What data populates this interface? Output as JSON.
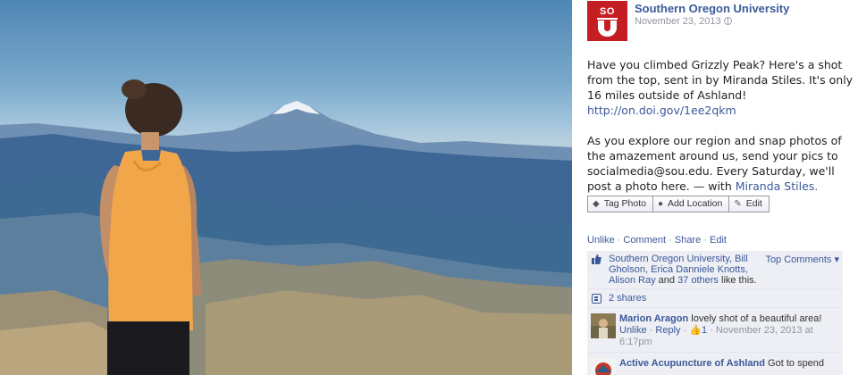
{
  "post": {
    "page_name": "Southern Oregon University",
    "date": "November 23, 2013",
    "privacy_icon": "globe-icon",
    "logo_text": "SO",
    "caption_p1": "Have you climbed Grizzly Peak? Here's a shot from the top, sent in by Miranda Stiles. It's only 16 miles outside of Ashland!",
    "link": "http://on.doi.gov/1ee2qkm",
    "caption_p2": "As you explore our region and snap photos of the amazement around us, send your pics to socialmedia@sou.edu. Every Saturday, we'll post a photo here. — with",
    "tagged_person": "Miranda Stiles."
  },
  "photo_actions": {
    "tag_photo": "Tag Photo",
    "add_location": "Add Location",
    "edit": "Edit"
  },
  "actions": {
    "unlike": "Unlike",
    "comment": "Comment",
    "share": "Share",
    "edit": "Edit",
    "separator": "·"
  },
  "likes": {
    "names": "Southern Oregon University, Bill Gholson, Erica Danniele Knotts, Alison Ray",
    "and": "and",
    "others": "37 others",
    "suffix": "like this.",
    "top_comments": "Top Comments ▾"
  },
  "shares": {
    "label": "2 shares"
  },
  "comments": [
    {
      "author": "Marion Aragon",
      "text": "lovely shot of a beautiful area!",
      "unlike": "Unlike",
      "reply": "Reply",
      "likes": "1",
      "timestamp": "November 23, 2013 at 6:17pm"
    },
    {
      "author": "Active Acupuncture of Ashland",
      "text": "Got to spend"
    }
  ],
  "colors": {
    "link_blue": "#3b5998",
    "brand_red": "#c41e24",
    "ufi_bg": "#edeff4"
  }
}
